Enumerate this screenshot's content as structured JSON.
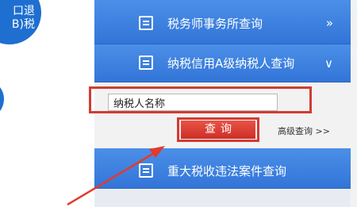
{
  "left_panel": {
    "line1": "口退",
    "line2": "B)税"
  },
  "menu": {
    "items": [
      {
        "label": "税务师事务所查询",
        "icon": "document-list-icon",
        "chevron": "»"
      },
      {
        "label": "纳税信用A级纳税人查询",
        "icon": "document-icon",
        "chevron": "∨"
      },
      {
        "label": "重大税收违法案件查询",
        "icon": "edit-document-icon"
      }
    ]
  },
  "search": {
    "input_value": "纳税人名称",
    "query_label": "查询",
    "advanced_label": "高级查询 >>"
  },
  "colors": {
    "menu_blue": "#3a7fdf",
    "button_red": "#d9362e",
    "highlight_red": "#d33b33",
    "circle_blue": "#1f6fd0"
  }
}
